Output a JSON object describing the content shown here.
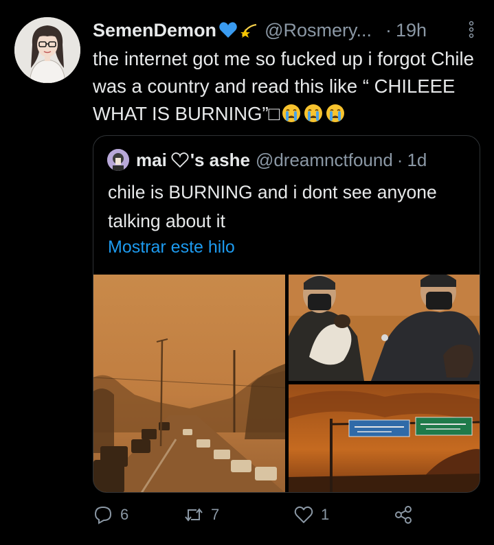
{
  "tweet": {
    "display_name": "SemenDemon",
    "handle": "@Rosmery...",
    "separator": "·",
    "time": "19h",
    "text_main": "the internet got me so fucked up i forgot Chile was a country and read this like “ CHILEEE WHAT IS BURNING”",
    "text_glyph": "□",
    "icons": [
      "blue-heart-icon",
      "dizzy-star-icon",
      "crying-face-icon",
      "more-options-icon"
    ]
  },
  "quote": {
    "display_name": "mai",
    "name_suffix": "'s ashe",
    "handle": "@dreamnctfound",
    "separator": "·",
    "time": "1d",
    "text": "chile is BURNING and i dont see anyone talking about it",
    "show_thread": "Mostrar este hilo",
    "photos": [
      "smoke-filled-highway-traffic-photo",
      "firefighters-with-rescued-dog-photo",
      "highway-sign-under-orange-sky-photo"
    ]
  },
  "actions": {
    "replies": "6",
    "retweets": "7",
    "likes": "1",
    "icons": [
      "reply-icon",
      "retweet-icon",
      "like-icon",
      "share-icon"
    ]
  },
  "colors": {
    "background": "#000000",
    "text": "#e7e9ea",
    "muted": "#8b98a5",
    "link": "#1d9bf0",
    "border": "#2f3336"
  }
}
